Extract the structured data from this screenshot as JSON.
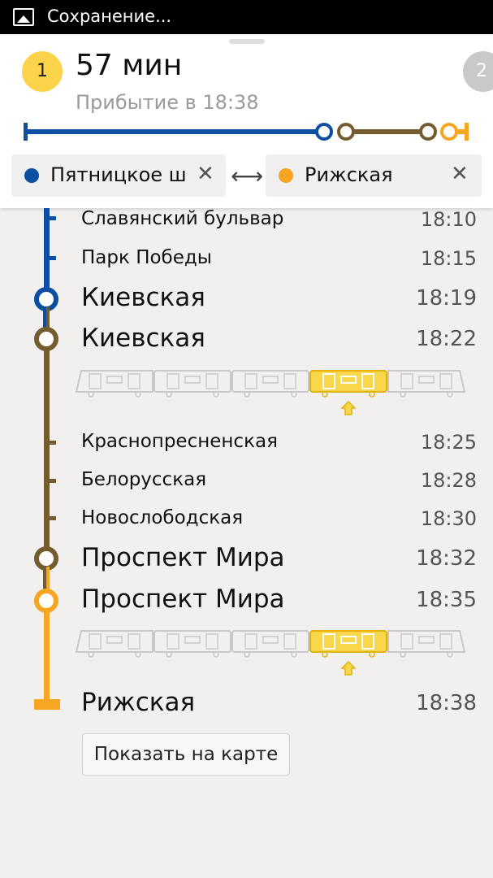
{
  "status_bar": {
    "text": "Сохранение...",
    "icon": "image-icon"
  },
  "route": {
    "index": "1",
    "next_index": "2",
    "duration": "57 мин",
    "arrival": "Прибытие в 18:38"
  },
  "from": {
    "name": "Пятницкое шоссе",
    "color": "#0b4ea2"
  },
  "to": {
    "name": "Рижская",
    "color": "#f6a623"
  },
  "colors": {
    "blue_line": "#0b4ea2",
    "brown_line": "#745c2f",
    "orange_line": "#f6a623",
    "highlight_car": "#f9d74a"
  },
  "stops": [
    {
      "name": "Славянский бульвар",
      "time": "18:10"
    },
    {
      "name": "Парк Победы",
      "time": "18:15"
    },
    {
      "name": "Киевская",
      "time": "18:19"
    },
    {
      "name": "Киевская",
      "time": "18:22"
    },
    {
      "name": "Краснопресненская",
      "time": "18:25"
    },
    {
      "name": "Белорусская",
      "time": "18:28"
    },
    {
      "name": "Новослободская",
      "time": "18:30"
    },
    {
      "name": "Проспект Мира",
      "time": "18:32"
    },
    {
      "name": "Проспект Мира",
      "time": "18:35"
    },
    {
      "name": "Рижская",
      "time": "18:38"
    }
  ],
  "trains": [
    {
      "recommended_car": 4,
      "cars": 5
    },
    {
      "recommended_car": 4,
      "cars": 5
    }
  ],
  "show_on_map_label": "Показать на карте"
}
